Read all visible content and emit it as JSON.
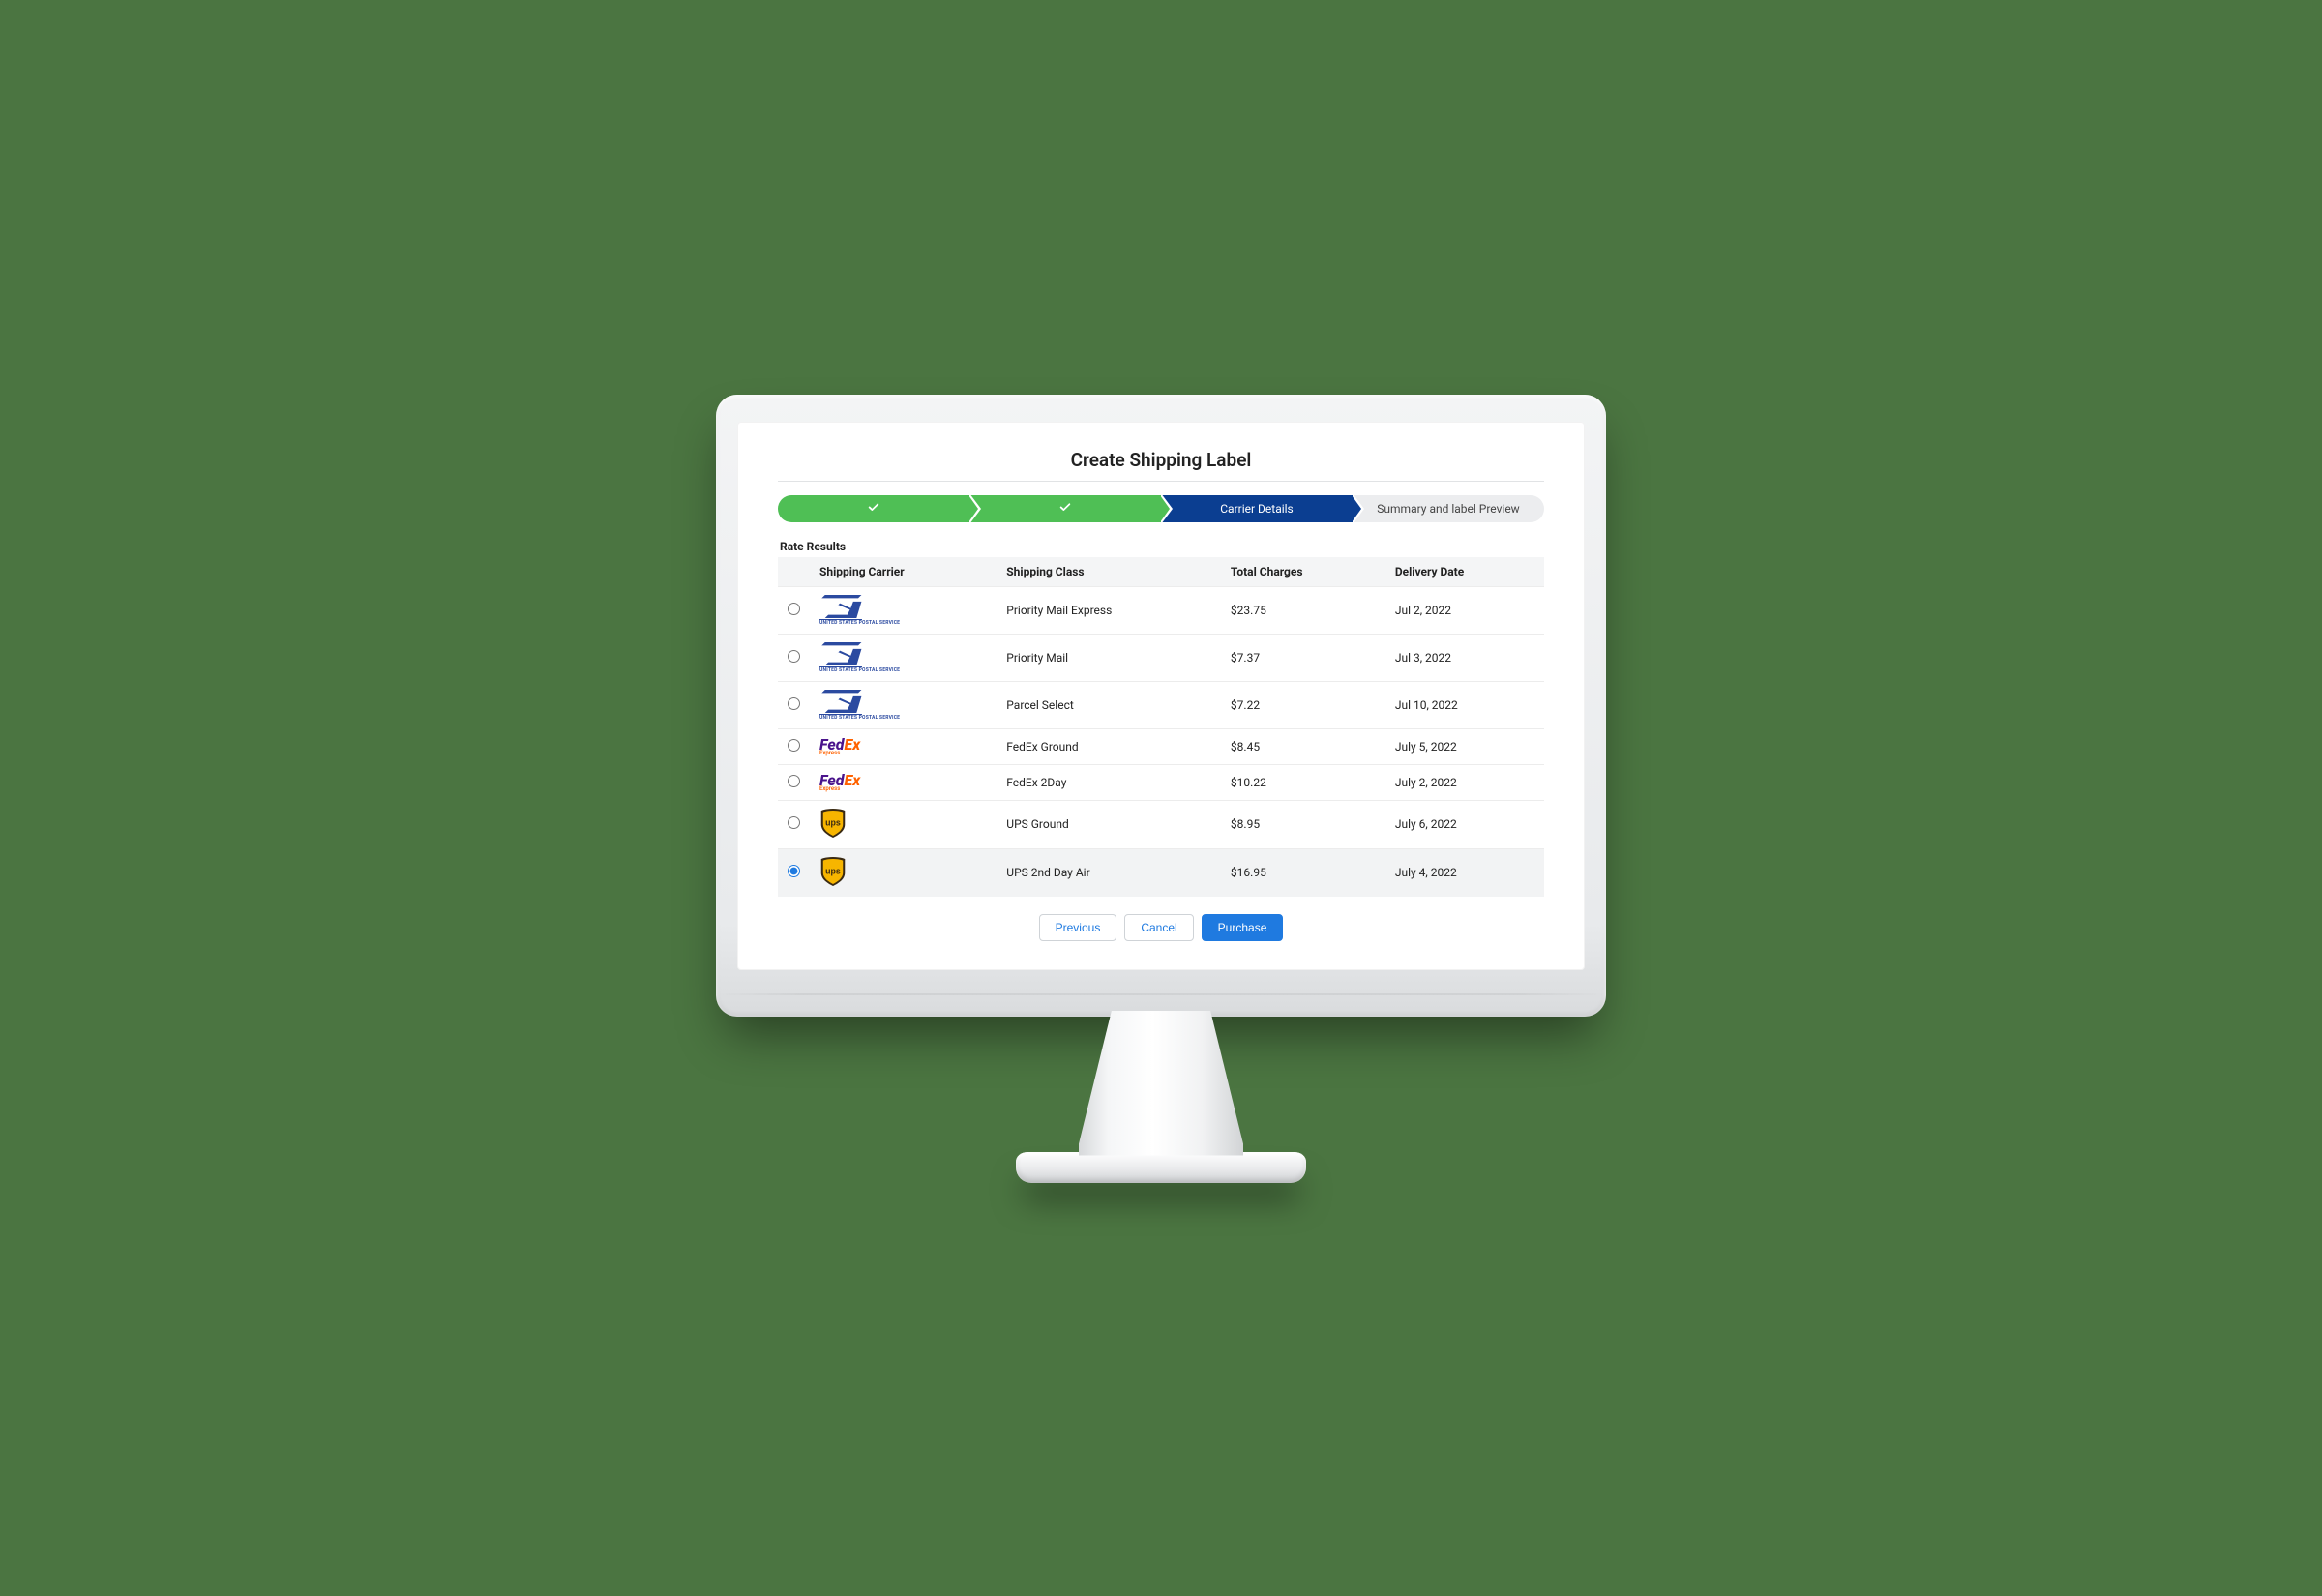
{
  "page": {
    "title": "Create Shipping Label"
  },
  "wizard": {
    "steps": [
      {
        "label": "",
        "status": "done"
      },
      {
        "label": "",
        "status": "done"
      },
      {
        "label": "Carrier Details",
        "status": "active"
      },
      {
        "label": "Summary and label Preview",
        "status": "todo"
      }
    ]
  },
  "rates": {
    "section_title": "Rate Results",
    "headers": {
      "carrier": "Shipping Carrier",
      "class": "Shipping Class",
      "charges": "Total Charges",
      "delivery": "Delivery Date"
    },
    "rows": [
      {
        "carrier": "usps",
        "class": "Priority Mail Express",
        "charges": "$23.75",
        "delivery": "Jul 2, 2022",
        "selected": false
      },
      {
        "carrier": "usps",
        "class": "Priority Mail",
        "charges": "$7.37",
        "delivery": "Jul 3, 2022",
        "selected": false
      },
      {
        "carrier": "usps",
        "class": "Parcel Select",
        "charges": "$7.22",
        "delivery": "Jul 10, 2022",
        "selected": false
      },
      {
        "carrier": "fedex",
        "class": "FedEx Ground",
        "charges": "$8.45",
        "delivery": "July 5, 2022",
        "selected": false
      },
      {
        "carrier": "fedex",
        "class": "FedEx 2Day",
        "charges": "$10.22",
        "delivery": "July 2, 2022",
        "selected": false
      },
      {
        "carrier": "ups",
        "class": "UPS Ground",
        "charges": "$8.95",
        "delivery": "July 6, 2022",
        "selected": false
      },
      {
        "carrier": "ups",
        "class": "UPS 2nd Day Air",
        "charges": "$16.95",
        "delivery": "July 4, 2022",
        "selected": true
      }
    ]
  },
  "carriers": {
    "usps": {
      "name": "USPS",
      "sublabel": "UNITED STATES POSTAL SERVICE"
    },
    "fedex": {
      "name": "FedEx",
      "sublabel": "Express"
    },
    "ups": {
      "name": "UPS",
      "sublabel": ""
    }
  },
  "actions": {
    "previous": "Previous",
    "cancel": "Cancel",
    "purchase": "Purchase"
  }
}
